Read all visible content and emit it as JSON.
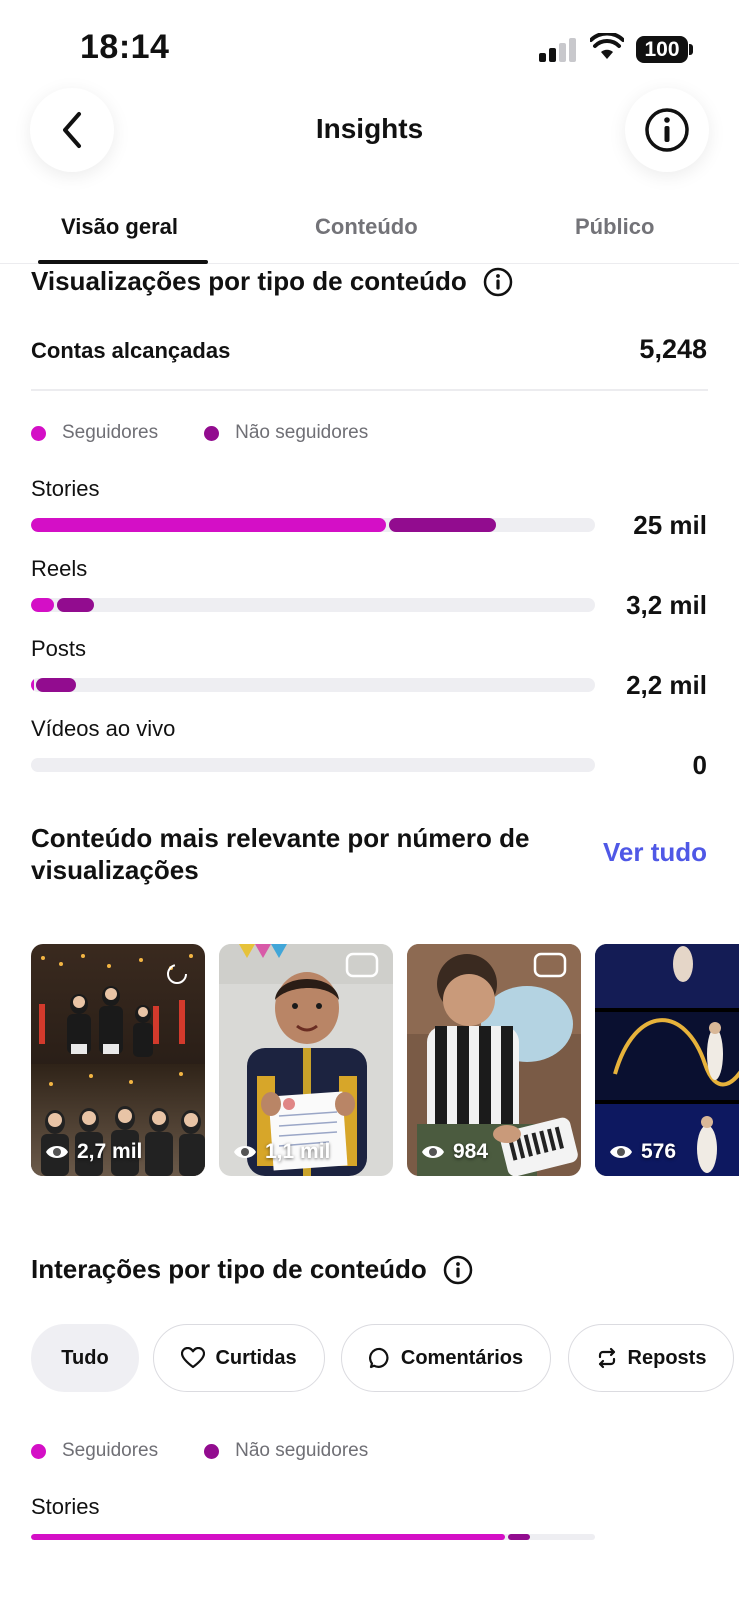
{
  "status_bar": {
    "time": "18:14",
    "battery": "100"
  },
  "header": {
    "title": "Insights"
  },
  "tabs": [
    {
      "label": "Visão geral",
      "active": true
    },
    {
      "label": "Conteúdo",
      "active": false
    },
    {
      "label": "Público",
      "active": false
    }
  ],
  "views_section": {
    "title": "Visualizações por tipo de conteúdo",
    "reach_label": "Contas alcançadas",
    "reach_value": "5,248",
    "legend": {
      "followers": "Seguidores",
      "non_followers": "Não seguidores"
    },
    "rows": [
      {
        "label": "Stories",
        "value": "25 mil",
        "followers_fraction": 0.63,
        "non_followers_fraction": 0.19
      },
      {
        "label": "Reels",
        "value": "3,2 mil",
        "followers_fraction": 0.04,
        "non_followers_fraction": 0.066
      },
      {
        "label": "Posts",
        "value": "2,2 mil",
        "followers_fraction": 0.004,
        "non_followers_fraction": 0.07
      },
      {
        "label": "Vídeos ao vivo",
        "value": "0",
        "followers_fraction": 0,
        "non_followers_fraction": 0
      }
    ]
  },
  "top_content": {
    "title": "Conteúdo mais relevante por número de visualizações",
    "see_all": "Ver tudo",
    "items": [
      {
        "views": "2,7 mil",
        "type": "post"
      },
      {
        "views": "1,1 mil",
        "type": "reel"
      },
      {
        "views": "984",
        "type": "reel"
      },
      {
        "views": "576",
        "type": "reel"
      }
    ]
  },
  "interactions_section": {
    "title": "Interações por tipo de conteúdo",
    "chips": [
      {
        "label": "Tudo",
        "icon": "",
        "active": true
      },
      {
        "label": "Curtidas",
        "icon": "heart-icon",
        "active": false
      },
      {
        "label": "Comentários",
        "icon": "comment-icon",
        "active": false
      },
      {
        "label": "Reposts",
        "icon": "repost-icon",
        "active": false
      }
    ],
    "legend": {
      "followers": "Seguidores",
      "non_followers": "Não seguidores"
    },
    "rows": [
      {
        "label": "Stories",
        "followers_fraction": 0.84,
        "non_followers_fraction": 0.04
      }
    ]
  },
  "colors": {
    "followers": "#d40fc6",
    "non_followers": "#920c8f",
    "track": "#eeeef2",
    "link": "#4f58e6"
  }
}
